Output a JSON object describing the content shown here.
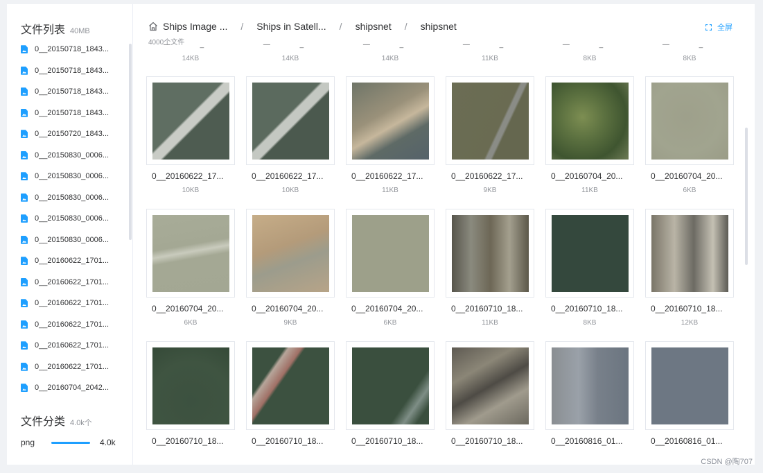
{
  "sidebar": {
    "title": "文件列表",
    "total_size": "40MB",
    "files": [
      "0__20150718_1843...",
      "0__20150718_1843...",
      "0__20150718_1843...",
      "0__20150718_1843...",
      "0__20150720_1843...",
      "0__20150830_0006...",
      "0__20150830_0006...",
      "0__20150830_0006...",
      "0__20150830_0006...",
      "0__20150830_0006...",
      "0__20160622_1701...",
      "0__20160622_1701...",
      "0__20160622_1701...",
      "0__20160622_1701...",
      "0__20160622_1701...",
      "0__20160622_1701...",
      "0__20160704_2042..."
    ],
    "category_title": "文件分类",
    "category_count": "4.0k个",
    "categories": [
      {
        "name": "png",
        "count": "4.0k",
        "fraction": 1.0
      }
    ]
  },
  "breadcrumb": {
    "items": [
      "Ships Image ...",
      "Ships in Satell...",
      "shipsnet",
      "shipsnet"
    ],
    "separator": "/"
  },
  "file_count": "4000个文件",
  "fullscreen_label": "全屏",
  "top_row_sizes": [
    "14KB",
    "14KB",
    "14KB",
    "11KB",
    "8KB",
    "8KB"
  ],
  "top_row_dash": "—  _",
  "tiles": [
    {
      "name": "0__20160622_17...",
      "size": "10KB"
    },
    {
      "name": "0__20160622_17...",
      "size": "10KB"
    },
    {
      "name": "0__20160622_17...",
      "size": "11KB"
    },
    {
      "name": "0__20160622_17...",
      "size": "9KB"
    },
    {
      "name": "0__20160704_20...",
      "size": "11KB"
    },
    {
      "name": "0__20160704_20...",
      "size": "6KB"
    },
    {
      "name": "0__20160704_20...",
      "size": "6KB"
    },
    {
      "name": "0__20160704_20...",
      "size": "9KB"
    },
    {
      "name": "0__20160704_20...",
      "size": "6KB"
    },
    {
      "name": "0__20160710_18...",
      "size": "11KB"
    },
    {
      "name": "0__20160710_18...",
      "size": "8KB"
    },
    {
      "name": "0__20160710_18...",
      "size": "12KB"
    },
    {
      "name": "0__20160710_18...",
      "size": ""
    },
    {
      "name": "0__20160710_18...",
      "size": ""
    },
    {
      "name": "0__20160710_18...",
      "size": ""
    },
    {
      "name": "0__20160710_18...",
      "size": ""
    },
    {
      "name": "0__20160816_01...",
      "size": ""
    },
    {
      "name": "0__20160816_01...",
      "size": ""
    }
  ],
  "watermark": "CSDN @陶707",
  "colors": {
    "accent": "#1e9fff",
    "muted": "#909399",
    "text": "#303133"
  }
}
